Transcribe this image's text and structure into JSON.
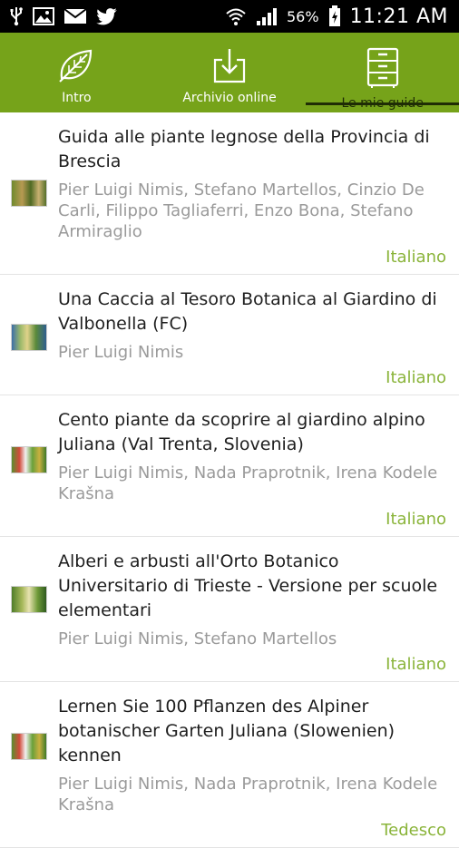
{
  "status_bar": {
    "battery_percent": "56%",
    "time": "11:21 AM",
    "icons": [
      "usb-icon",
      "image-icon",
      "mail-icon",
      "twitter-icon",
      "wifi-icon",
      "signal-icon",
      "battery-icon"
    ]
  },
  "tabs": [
    {
      "label": "Intro",
      "icon": "leaf-icon"
    },
    {
      "label": "Archivio online",
      "icon": "download-icon"
    },
    {
      "label": "Le mie guide",
      "icon": "file-cabinet-icon",
      "active": true
    }
  ],
  "colors": {
    "accent": "#76a31a",
    "language": "#8ab43a",
    "indicator": "#1f2d05"
  },
  "guides": [
    {
      "title": "Guida alle piante legnose della Provincia di Brescia",
      "authors": "Pier Luigi Nimis, Stefano Martellos, Cinzio De Carli, Filippo Tagliaferri, Enzo Bona, Stefano Armiraglio",
      "language": "Italiano"
    },
    {
      "title": "Una Caccia al Tesoro Botanica al Giardino di Valbonella (FC)",
      "authors": "Pier Luigi Nimis",
      "language": "Italiano"
    },
    {
      "title": "Cento piante da scoprire al giardino alpino Juliana (Val Trenta, Slovenia)",
      "authors": "Pier Luigi Nimis, Nada Praprotnik, Irena Kodele Krašna",
      "language": "Italiano"
    },
    {
      "title": "Alberi e arbusti all'Orto Botanico Universitario di Trieste - Versione per scuole elementari",
      "authors": "Pier Luigi Nimis, Stefano Martellos",
      "language": "Italiano"
    },
    {
      "title": "Lernen Sie 100 Pflanzen  des Alpiner botanischer Garten Juliana (Slowenien) kennen",
      "authors": "Pier Luigi Nimis, Nada Praprotnik, Irena Kodele Krašna",
      "language": "Tedesco"
    }
  ]
}
